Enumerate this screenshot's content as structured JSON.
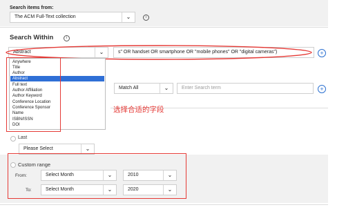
{
  "search_items": {
    "label": "Search items from:",
    "collection": "The ACM Full-Text collection"
  },
  "search_within": {
    "title": "Search Within",
    "field_selected": "Abstract",
    "query_text": "s\" OR handset OR smartphone OR \"mobile phones\" OR \"digital cameras\")",
    "field_options": [
      "Anywhere",
      "Title",
      "Author",
      "Abstract",
      "Full text",
      "Author Affiliation",
      "Author Keyword",
      "Conference Location",
      "Conference Sponsor",
      "Name",
      "ISBN/ISSN",
      "DOI"
    ]
  },
  "second_row": {
    "match": "Match All",
    "placeholder": "Enter Search term"
  },
  "annotation": {
    "text": "选择合适的字段",
    "color": "#e53935"
  },
  "last": {
    "label": "Last",
    "select": "Please Select"
  },
  "custom_range": {
    "label": "Custom range",
    "from_label": "From:",
    "to_label": "To:",
    "from_month": "Select Month",
    "from_year": "2010",
    "to_month": "Select Month",
    "to_year": "2020"
  },
  "icons": {
    "info": "info-icon",
    "add": "plus-circle-icon",
    "dropdown": "chevron-down-icon"
  },
  "colors": {
    "accent": "#2f6fd6",
    "highlight": "#e53935"
  }
}
